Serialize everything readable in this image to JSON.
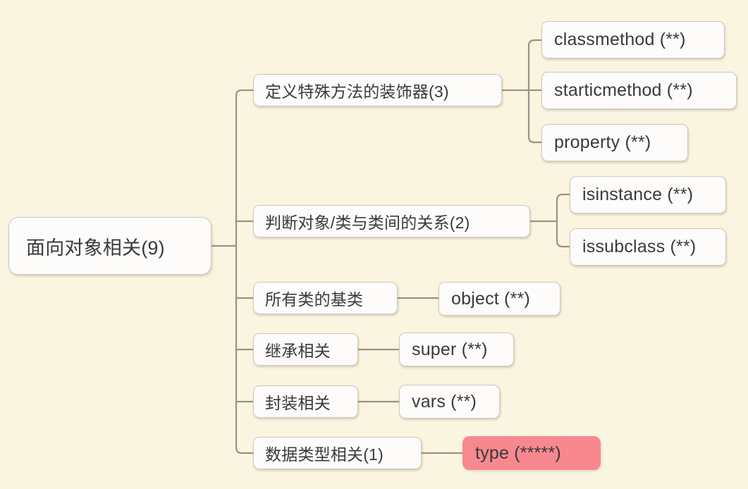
{
  "diagram": {
    "type": "mind-map",
    "title": "面向对象相关(9)",
    "background_color": "#faf5e0",
    "node_color": "#fdfcfa",
    "node_border_color": "#cfc9be",
    "connector_color": "#9a9288",
    "highlight_color": "#f8888f",
    "root": {
      "label": "面向对象相关(9)"
    },
    "branches": [
      {
        "label": "定义特殊方法的装饰器(3)",
        "children": [
          {
            "label": "classmethod (**)"
          },
          {
            "label": "starticmethod (**)"
          },
          {
            "label": "property (**)"
          }
        ]
      },
      {
        "label": "判断对象/类与类间的关系(2)",
        "children": [
          {
            "label": "isinstance (**)"
          },
          {
            "label": "issubclass (**)"
          }
        ]
      },
      {
        "label": "所有类的基类",
        "children": [
          {
            "label": "object (**)"
          }
        ]
      },
      {
        "label": "继承相关",
        "children": [
          {
            "label": "super (**)"
          }
        ]
      },
      {
        "label": "封装相关",
        "children": [
          {
            "label": "vars (**)"
          }
        ]
      },
      {
        "label": "数据类型相关(1)",
        "children": [
          {
            "label": "type  (*****)",
            "highlight": true
          }
        ]
      }
    ]
  }
}
